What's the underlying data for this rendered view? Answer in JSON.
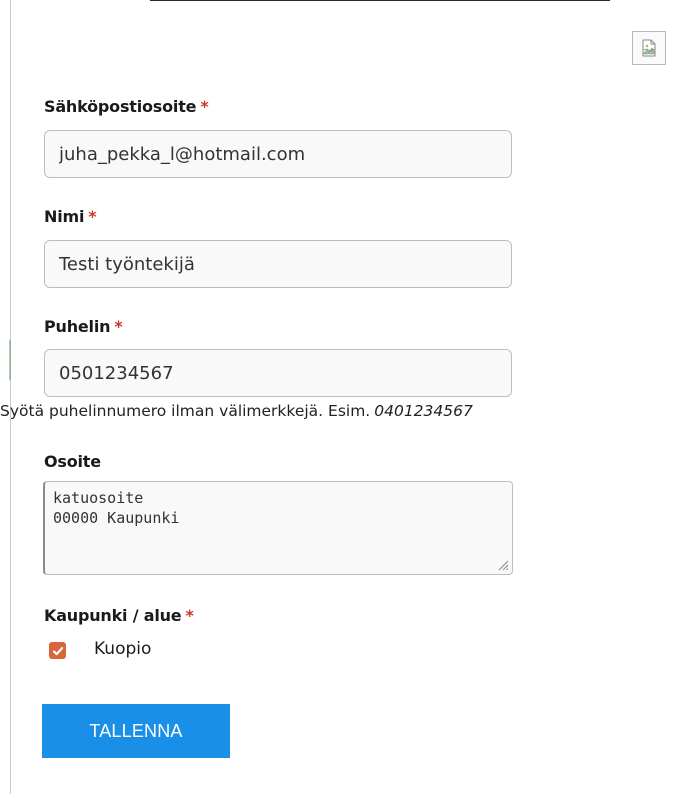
{
  "form": {
    "email": {
      "label": "Sähköpostiosoite",
      "required_mark": "*",
      "value": "juha_pekka_l@hotmail.com"
    },
    "name": {
      "label": "Nimi",
      "required_mark": "*",
      "value": "Testi työntekijä"
    },
    "phone": {
      "label": "Puhelin",
      "required_mark": "*",
      "value": "0501234567",
      "help_text": "Syötä puhelinnumero ilman välimerkkejä. Esim.",
      "help_example": "0401234567"
    },
    "address": {
      "label": "Osoite",
      "value": "katuosoite\n00000 Kaupunki"
    },
    "city": {
      "label": "Kaupunki / alue",
      "required_mark": "*",
      "options": [
        {
          "label": "Kuopio",
          "checked": true
        }
      ]
    },
    "save_label": "TALLENNA"
  },
  "colors": {
    "required": "#d0342c",
    "checkbox": "#d9653b",
    "button": "#1a8fe8"
  },
  "icons": {
    "top_right": "broken-image-icon",
    "checkbox": "checkmark-icon",
    "textarea_corner": "resize-grip-icon"
  }
}
